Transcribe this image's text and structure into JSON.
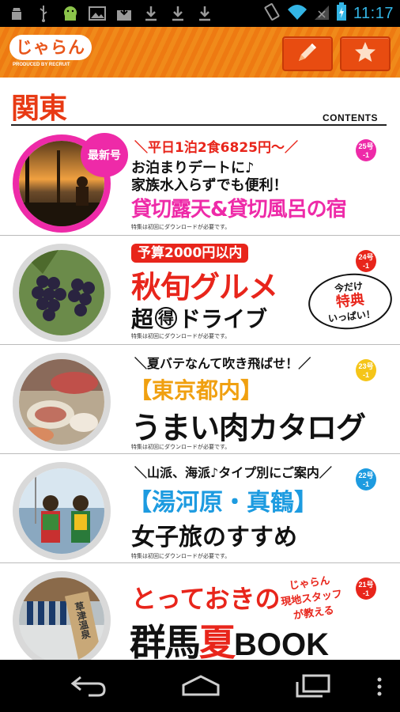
{
  "status_bar": {
    "time": "11:17",
    "left_icons": [
      "android-debug-icon",
      "usb-icon",
      "android-icon",
      "image-icon",
      "download-box-icon",
      "download-icon",
      "download-icon",
      "download-icon"
    ],
    "right_icons": [
      "vibrate-icon",
      "wifi-icon",
      "signal-icon",
      "battery-icon"
    ]
  },
  "header": {
    "logo_text": "じゃらん",
    "logo_sub": "PRODUCED BY RECRUIT",
    "edit_button": "pencil-icon",
    "favorite_button": "star-icon",
    "accent": "#f08a1a"
  },
  "section": {
    "region": "関東",
    "contents_label": "CONTENTS"
  },
  "issues": [
    {
      "badge": "最新号",
      "line1": "＼平日1泊2食6825円～／",
      "line2": "お泊まりデートに♪",
      "line3": "家族水入らずでも便利！",
      "title": "貸切露天&貸切風呂の宿",
      "issue_no": "25号",
      "issue_sub": "-1",
      "note": "特集は初回にダウンロードが必要です。",
      "color": "#ee2aa8"
    },
    {
      "tag": "予算2000円以内",
      "title": "秋旬グルメ",
      "sub_pre": "超",
      "sub_circle": "得",
      "sub_post": "ドライブ",
      "bubble_1": "今だけ",
      "bubble_2": "特典",
      "bubble_3": "いっぱい！",
      "issue_no": "24号",
      "issue_sub": "-1",
      "note": "特集は初回にダウンロードが必要です。",
      "color": "#e8251b"
    },
    {
      "line1": "＼夏バテなんて吹き飛ばせ！／",
      "bracket": "【東京都内】",
      "title": "うまい肉カタログ",
      "issue_no": "23号",
      "issue_sub": "-1",
      "note": "特集は初回にダウンロードが必要です。",
      "color": "#f5c518"
    },
    {
      "line1": "＼山派、海派♪タイプ別にご案内／",
      "bracket": "【湯河原・真鶴】",
      "title": "女子旅のすすめ",
      "issue_no": "22号",
      "issue_sub": "-1",
      "note": "特集は初回にダウンロードが必要です。",
      "color": "#1d9be0"
    },
    {
      "title_a": "とっておきの",
      "title_b1": "群馬",
      "title_b2": "夏",
      "title_b3": "BOOK",
      "side_1": "じゃらん",
      "side_2": "現地スタッフ",
      "side_3": "が教える",
      "thumb_text": "草津温泉",
      "issue_no": "21号",
      "issue_sub": "-1",
      "color": "#e8251b"
    }
  ],
  "nav_bar": {
    "back": "back-icon",
    "home": "home-icon",
    "recents": "recents-icon",
    "menu": "menu-icon"
  }
}
